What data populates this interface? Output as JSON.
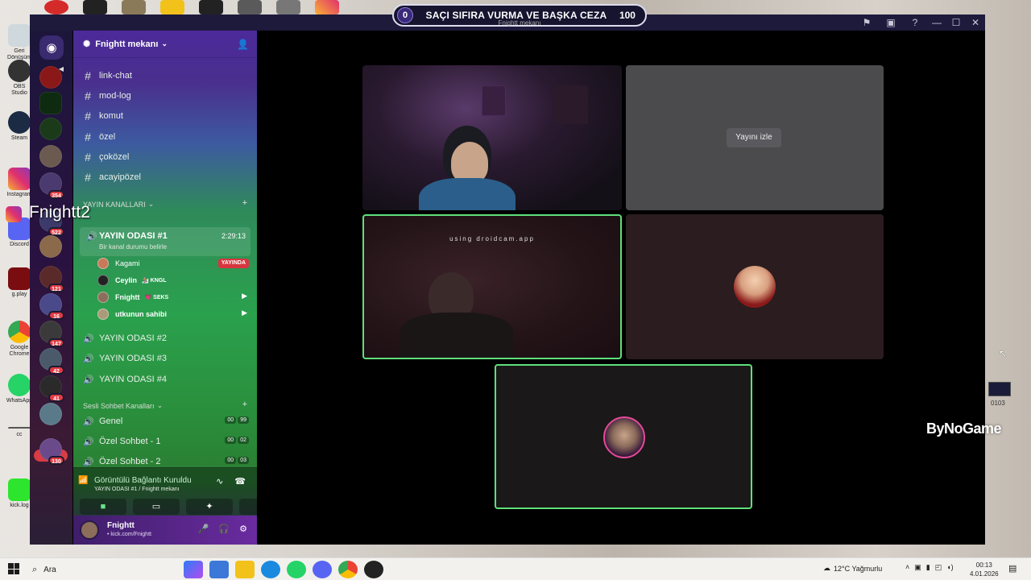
{
  "banner": {
    "left_value": "0",
    "title": "SAÇI SIFIRA VURMA VE BAŞKA CEZA",
    "right_value": "100",
    "subtitle": "Fnightt mekanı"
  },
  "overlay": {
    "streamer_name": "Fnightt2",
    "brand": "ByNoGame"
  },
  "desktop_icons": [
    {
      "label": "Geri Dönüşüm"
    },
    {
      "label": "OBS Studio"
    },
    {
      "label": "Steam"
    },
    {
      "label": "Instagram"
    },
    {
      "label": "Discord"
    },
    {
      "label": "g.play"
    },
    {
      "label": "Google Chrome"
    },
    {
      "label": "WhatsApp"
    },
    {
      "label": "cc"
    },
    {
      "label": "kick.log"
    }
  ],
  "right_desk": {
    "label": "0103"
  },
  "servers": [
    {
      "badge": ""
    },
    {
      "badge": ""
    },
    {
      "badge": ""
    },
    {
      "badge": ""
    },
    {
      "badge": "354"
    },
    {
      "badge": "522"
    },
    {
      "badge": ""
    },
    {
      "badge": "121"
    },
    {
      "badge": "16"
    },
    {
      "badge": ""
    },
    {
      "badge": "147"
    },
    {
      "badge": "42"
    },
    {
      "badge": "41"
    },
    {
      "badge": ""
    },
    {
      "badge": "130"
    }
  ],
  "rail": {
    "new_label": "YENİ"
  },
  "guild": {
    "name": "Fnightt mekanı"
  },
  "text_channels": [
    "link-chat",
    "mod-log",
    "komut",
    "özel",
    "çoközel",
    "acayipözel"
  ],
  "categories": {
    "stream": "YAYIN KANALLARI",
    "voice": "Sesli Sohbet Kanalları"
  },
  "active_channel": {
    "name": "YAYIN ODASI #1",
    "status": "Bir kanal durumu belirle",
    "timer": "2:29:13"
  },
  "members": [
    {
      "name": "Kagami",
      "tag": "",
      "right": "YAYINDA"
    },
    {
      "name": "Ceylin",
      "tag": "🏂 KNGL",
      "right": ""
    },
    {
      "name": "Fnightt",
      "tag": "💗 SEKS",
      "right": "cam"
    },
    {
      "name": "utkunun sahibi",
      "tag": "",
      "right": "cam"
    }
  ],
  "stream_rooms": [
    "YAYIN ODASI #2",
    "YAYIN ODASI #3",
    "YAYIN ODASI #4"
  ],
  "voice_channels": [
    {
      "name": "Genel",
      "a": "00",
      "b": "99"
    },
    {
      "name": "Özel Sohbet - 1",
      "a": "00",
      "b": "02"
    },
    {
      "name": "Özel Sohbet - 2",
      "a": "00",
      "b": "03"
    }
  ],
  "voice_status": {
    "title": "Görüntülü Bağlantı Kuruldu",
    "sub": "YAYIN ODASI #1 / Fnightt mekanı"
  },
  "user": {
    "name": "Fnightt",
    "sub": "• kick.com/Fnightt"
  },
  "stage": {
    "watch_label": "Yayını izle",
    "droidcam_text": "using droidcam.app"
  },
  "taskbar": {
    "search": "Ara",
    "weather": "12°C  Yağmurlu",
    "time": "00:13",
    "date": "4.01.2026"
  }
}
